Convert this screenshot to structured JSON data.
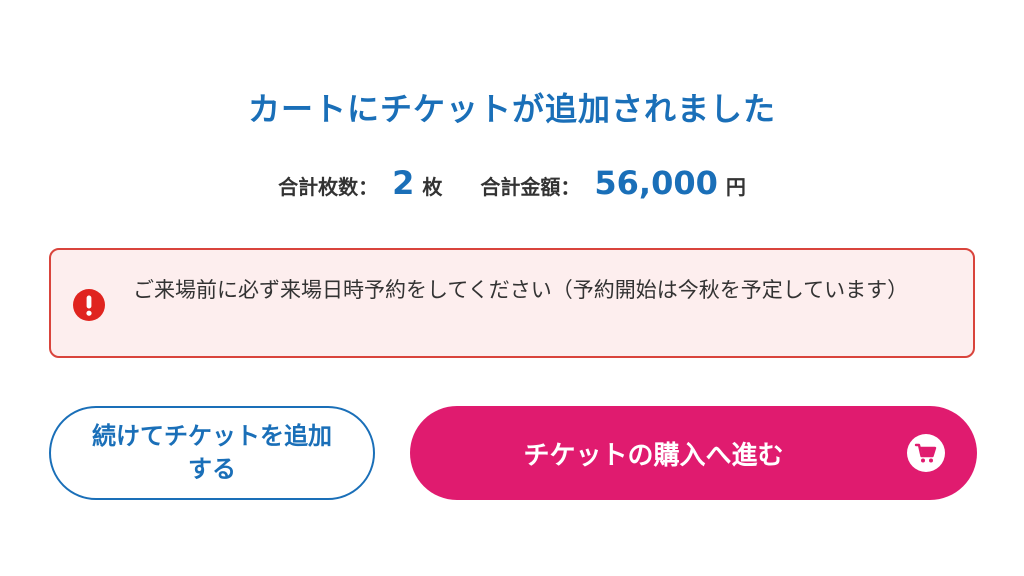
{
  "heading": "カートにチケットが追加されました",
  "summary": {
    "count_label": "合計枚数：",
    "count_value": "2",
    "count_unit": "枚",
    "amount_label": "合計金額：",
    "amount_value": "56,000",
    "amount_unit": "円"
  },
  "notice": {
    "icon": "exclamation-circle-icon",
    "text": "ご来場前に必ず来場日時予約をしてください（予約開始は今秋を予定しています）"
  },
  "buttons": {
    "continue_label": "続けてチケットを追加する",
    "purchase_label": "チケットの購入へ進む",
    "purchase_icon": "cart-icon"
  },
  "colors": {
    "accent_blue": "#1a6fb8",
    "purchase_pink": "#e01b6f",
    "alert_red": "#d9443c",
    "alert_bg": "#fdeeee"
  }
}
